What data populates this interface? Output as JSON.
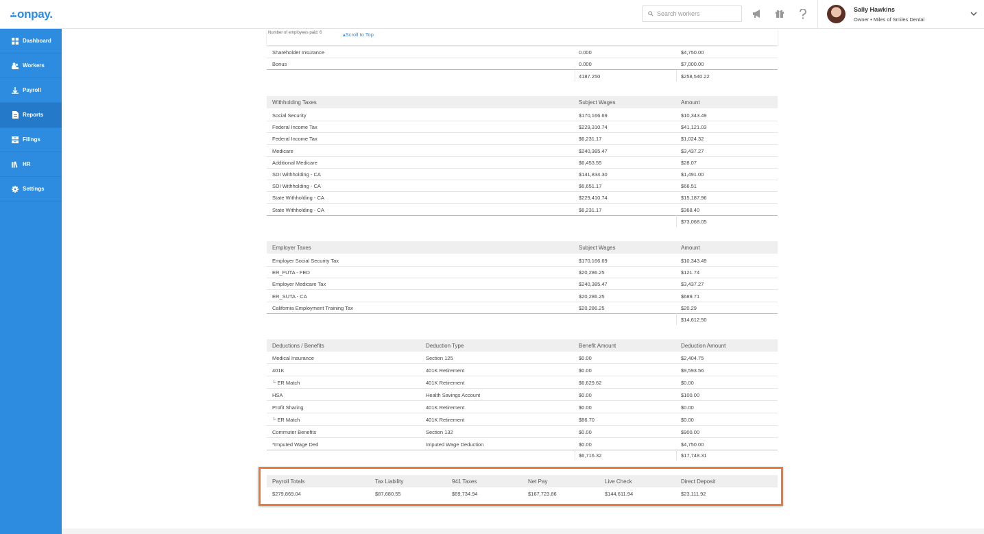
{
  "app": {
    "logo": "onpay."
  },
  "search": {
    "placeholder": "Search workers"
  },
  "user": {
    "name": "Sally Hawkins",
    "role": "Owner • Miles of Smiles Dental"
  },
  "nav": [
    {
      "label": "Dashboard",
      "icon": "dashboard-icon"
    },
    {
      "label": "Workers",
      "icon": "workers-icon"
    },
    {
      "label": "Payroll",
      "icon": "payroll-icon"
    },
    {
      "label": "Reports",
      "icon": "reports-icon",
      "active": true
    },
    {
      "label": "Filings",
      "icon": "filings-icon"
    },
    {
      "label": "HR",
      "icon": "hr-icon"
    },
    {
      "label": "Settings",
      "icon": "gear-icon"
    }
  ],
  "header": {
    "employees_paid": "Number of employees paid: 6",
    "scroll_top": "Scroll to Top"
  },
  "earnings": {
    "rows": [
      {
        "name": "Shareholder Insurance",
        "hours": "0.000",
        "amount": "$4,750.00"
      },
      {
        "name": "Bonus",
        "hours": "0.000",
        "amount": "$7,000.00"
      }
    ],
    "total_hours": "4187.250",
    "total_amount": "$258,540.22"
  },
  "withholding": {
    "headers": [
      "Withholding Taxes",
      "Subject Wages",
      "Amount"
    ],
    "rows": [
      [
        "Social Security",
        "$170,166.69",
        "$10,343.49"
      ],
      [
        "Federal Income Tax",
        "$229,310.74",
        "$41,121.03"
      ],
      [
        "Federal Income Tax",
        "$6,231.17",
        "$1,024.32"
      ],
      [
        "Medicare",
        "$240,385.47",
        "$3,437.27"
      ],
      [
        "Additional Medicare",
        "$6,453.55",
        "$28.07"
      ],
      [
        "SDI Withholding - CA",
        "$141,834.30",
        "$1,491.00"
      ],
      [
        "SDI Withholding - CA",
        "$6,651.17",
        "$66.51"
      ],
      [
        "State Withholding - CA",
        "$229,410.74",
        "$15,187.96"
      ],
      [
        "State Withholding - CA",
        "$6,231.17",
        "$368.40"
      ]
    ],
    "total": "$73,068.05"
  },
  "employer": {
    "headers": [
      "Employer Taxes",
      "Subject Wages",
      "Amount"
    ],
    "rows": [
      [
        "Employer Social Security Tax",
        "$170,166.69",
        "$10,343.49"
      ],
      [
        "ER_FUTA - FED",
        "$20,286.25",
        "$121.74"
      ],
      [
        "Employer Medicare Tax",
        "$240,385.47",
        "$3,437.27"
      ],
      [
        "ER_SUTA - CA",
        "$20,286.25",
        "$689.71"
      ],
      [
        "California Employment Training Tax",
        "$20,286.25",
        "$20.29"
      ]
    ],
    "total": "$14,612.50"
  },
  "deductions": {
    "headers": [
      "Deductions / Benefits",
      "Deduction Type",
      "Benefit Amount",
      "Deduction Amount"
    ],
    "rows": [
      [
        "Medical Insurance",
        "Section 125",
        "$0.00",
        "$2,404.75"
      ],
      [
        "401K",
        "401K Retirement",
        "$0.00",
        "$9,593.56"
      ],
      [
        "└ ER Match",
        "401K Retirement",
        "$6,629.62",
        "$0.00"
      ],
      [
        "HSA",
        "Health Savings Account",
        "$0.00",
        "$100.00"
      ],
      [
        "Profit Sharing",
        "401K Retirement",
        "$0.00",
        "$0.00"
      ],
      [
        "└ ER Match",
        "401K Retirement",
        "$86.70",
        "$0.00"
      ],
      [
        "Commuter Benefits",
        "Section 132",
        "$0.00",
        "$900.00"
      ],
      [
        "*Imputed Wage Ded",
        "Imputed Wage Deduction",
        "$0.00",
        "$4,750.00"
      ]
    ],
    "total_benefit": "$6,716.32",
    "total_deduction": "$17,748.31"
  },
  "payroll_totals": {
    "headers": [
      "Payroll Totals",
      "Tax Liability",
      "941 Taxes",
      "Net Pay",
      "Live Check",
      "Direct Deposit"
    ],
    "values": [
      "$279,869.04",
      "$87,680.55",
      "$69,734.94",
      "$167,723.86",
      "$144,611.94",
      "$23,111.92"
    ]
  },
  "colors": {
    "brand": "#2d8be0",
    "highlight": "#e57c3d"
  }
}
